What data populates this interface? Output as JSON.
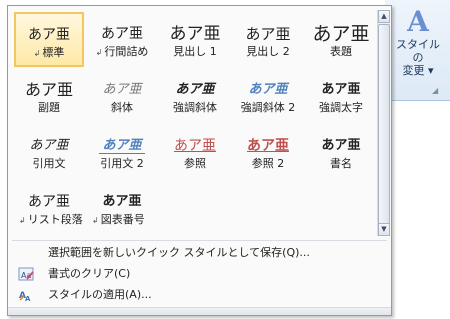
{
  "ribbon": {
    "change_styles_label_1": "スタイルの",
    "change_styles_label_2": "変更",
    "change_styles_arrow": "▾"
  },
  "gallery": {
    "rows": [
      [
        {
          "sample": "あア亜",
          "name": "標準",
          "mark": "↲",
          "selected": true
        },
        {
          "sample": "あア亜",
          "name": "行間詰め",
          "mark": "↲"
        },
        {
          "sample": "あア亜",
          "name": "見出し 1"
        },
        {
          "sample": "あア亜",
          "name": "見出し 2"
        },
        {
          "sample": "あア亜",
          "name": "表題"
        }
      ],
      [
        {
          "sample": "あア亜",
          "name": "副題"
        },
        {
          "sample": "あア亜",
          "name": "斜体"
        },
        {
          "sample": "あア亜",
          "name": "強調斜体"
        },
        {
          "sample": "あア亜",
          "name": "強調斜体 2"
        },
        {
          "sample": "あア亜",
          "name": "強調太字"
        }
      ],
      [
        {
          "sample": "あア亜",
          "name": "引用文"
        },
        {
          "sample": "あア亜",
          "name": "引用文 2"
        },
        {
          "sample": "あア亜",
          "name": "参照"
        },
        {
          "sample": "あア亜",
          "name": "参照 2"
        },
        {
          "sample": "あア亜",
          "name": "書名"
        }
      ],
      [
        {
          "sample": "あア亜",
          "name": "リスト段落",
          "mark": "↲"
        },
        {
          "sample": "あア亜",
          "name": "図表番号",
          "mark": "↲"
        }
      ]
    ]
  },
  "scrollbar": {
    "up": "▲",
    "down": "▼"
  },
  "menu": {
    "save_selection": "選択範囲を新しいクイック スタイルとして保存(Q)...",
    "clear_formatting": "書式のクリア(C)",
    "apply_styles": "スタイルの適用(A)..."
  },
  "colors": {
    "accent_blue": "#4f81bd",
    "accent_red": "#c0504d",
    "selection_border": "#f2c760"
  }
}
